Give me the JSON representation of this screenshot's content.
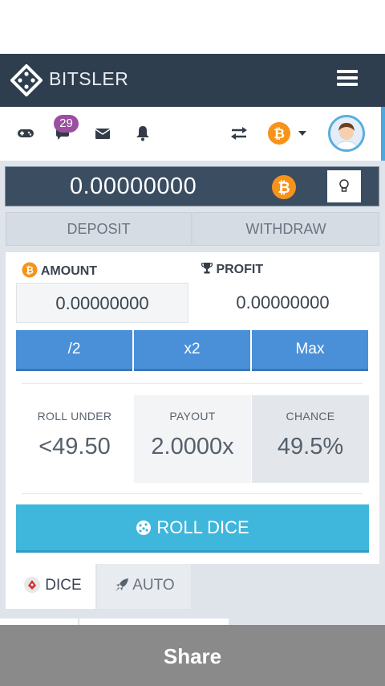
{
  "header": {
    "brand": "BITSLER"
  },
  "iconbar": {
    "chat_badge": "29",
    "icons": [
      "gamepad-icon",
      "chat-icon",
      "mail-icon",
      "bell-icon",
      "exchange-icon",
      "bitcoin-icon",
      "avatar"
    ]
  },
  "balance": {
    "value": "0.00000000",
    "currency_symbol": "₿"
  },
  "wallet_tabs": {
    "deposit": "DEPOSIT",
    "withdraw": "WITHDRAW"
  },
  "bet": {
    "amount_label": "AMOUNT",
    "profit_label": "PROFIT",
    "amount_value": "0.00000000",
    "profit_value": "0.00000000",
    "buttons": {
      "half": "/2",
      "double": "x2",
      "max": "Max"
    }
  },
  "stats": {
    "roll_under_label": "ROLL UNDER",
    "roll_under_value": "<49.50",
    "payout_label": "PAYOUT",
    "payout_value": "2.0000x",
    "chance_label": "CHANCE",
    "chance_value": "49.5%"
  },
  "actions": {
    "roll_dice": "ROLL DICE"
  },
  "game_tabs": {
    "dice": "DICE",
    "auto": "AUTO"
  },
  "footer": {
    "share": "Share"
  },
  "colors": {
    "navbar": "#2f3e4e",
    "accent_blue": "#4a90d9",
    "roll_button": "#3fb6dc",
    "bitcoin_orange": "#f7931a",
    "badge_purple": "#9b4fa0"
  }
}
